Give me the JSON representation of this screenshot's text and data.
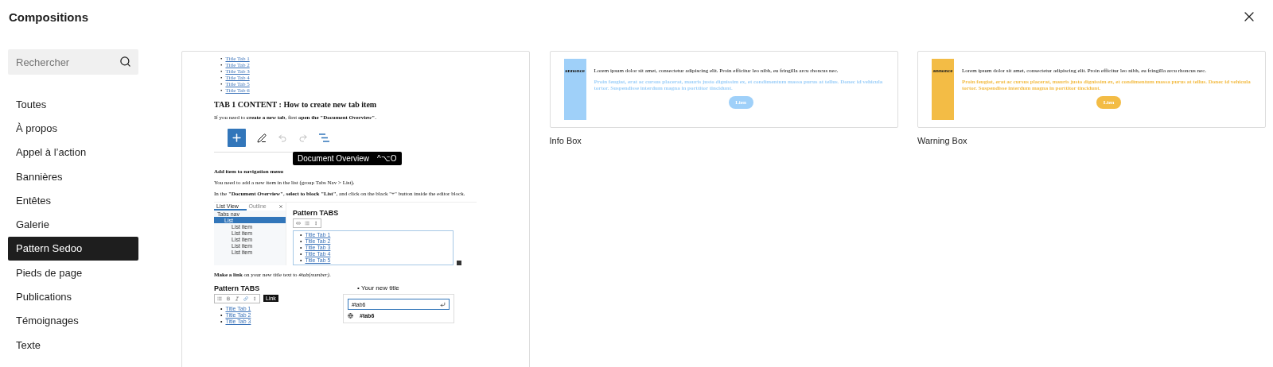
{
  "dialog": {
    "title": "Compositions"
  },
  "search": {
    "placeholder": "Rechercher"
  },
  "categories": [
    {
      "label": "Toutes",
      "selected": false
    },
    {
      "label": "À propos",
      "selected": false
    },
    {
      "label": "Appel à l’action",
      "selected": false
    },
    {
      "label": "Bannières",
      "selected": false
    },
    {
      "label": "Entêtes",
      "selected": false
    },
    {
      "label": "Galerie",
      "selected": false
    },
    {
      "label": "Pattern Sedoo",
      "selected": true
    },
    {
      "label": "Pieds de page",
      "selected": false
    },
    {
      "label": "Publications",
      "selected": false
    },
    {
      "label": "Témoignages",
      "selected": false
    },
    {
      "label": "Texte",
      "selected": false
    }
  ],
  "patterns": [
    {
      "kind": "tabs",
      "preview": {
        "bullet": "•",
        "tab_links": [
          "Title Tab 1",
          "Title Tab 2",
          "Title Tab 3",
          "Title Tab 4",
          "Title Tab 5",
          "Title Tab 6"
        ],
        "heading": "TAB 1 CONTENT : How to create new tab item",
        "intro": "If you need to **create a new tab**, first **open the \"Document Overview\"**.",
        "tooltip": {
          "label": "Document Overview",
          "shortcut": "^⌥O"
        },
        "subheading": "Add item to navigation menu",
        "steps": [
          "You need to add a new item in the list (group Tabs Nav > List).",
          "In the **\"Document Overview\"**, **select to block \"List\"**, and click on the black \"+\" button inside the editor block."
        ],
        "screenshot_1": {
          "tabs": [
            {
              "label": "List View",
              "selected": true
            },
            {
              "label": "Outline",
              "selected": false
            }
          ],
          "tree": [
            {
              "label": "Tabs nav",
              "selected": false,
              "children": [
                {
                  "label": "List",
                  "selected": true,
                  "children": [
                    {
                      "label": "List item",
                      "selected": false
                    },
                    {
                      "label": "List item",
                      "selected": false
                    },
                    {
                      "label": "List item",
                      "selected": false
                    },
                    {
                      "label": "List item",
                      "selected": false
                    },
                    {
                      "label": "List item",
                      "selected": false
                    }
                  ]
                }
              ]
            }
          ],
          "title": "Pattern TABS",
          "links": [
            "Title Tab 1",
            "Title Tab 2",
            "Title Tab 3",
            "Title Tab 4",
            "Title Tab 5"
          ]
        },
        "link_step": "**Make a link** on your new title text to *#tab(number)*.",
        "screenshot_2": {
          "title": "Pattern TABS",
          "links": [
            "Title Tab 1",
            "Title Tab 2",
            "Title Tab 3"
          ],
          "tooltip": "Link",
          "new_item": "Your new title",
          "url_value": "#tab6",
          "suggestion": "#tab6"
        }
      }
    },
    {
      "kind": "box",
      "label": "Info Box",
      "color": "#9fd0f9",
      "badge": "annonce",
      "text": "Lorem ipsum dolor sit amet, consectetur adipiscing elit. Proin efficitur leo nibh, eu fringilla arcu rhoncus nec.",
      "highlight": "Proin feugiat, erat ac cursus placerat, mauris justo dignissim ex, et condimentum massa purus at tellus. Donec id vehicula tortor. Suspendisse interdum magna in porttitor tincidunt.",
      "button": "Lien"
    },
    {
      "kind": "box",
      "label": "Warning Box",
      "color": "#f3bc45",
      "badge": "annonce",
      "text": "Lorem ipsum dolor sit amet, consectetur adipiscing elit. Proin efficitur leo nibh, eu fringilla arcu rhoncus nec.",
      "highlight": "Proin feugiat, erat ac cursus placerat, mauris justo dignissim ex, et condimentum massa purus at tellus. Donec id vehicula tortor. Suspendisse interdum magna in porttitor tincidunt.",
      "button": "Lien"
    }
  ]
}
